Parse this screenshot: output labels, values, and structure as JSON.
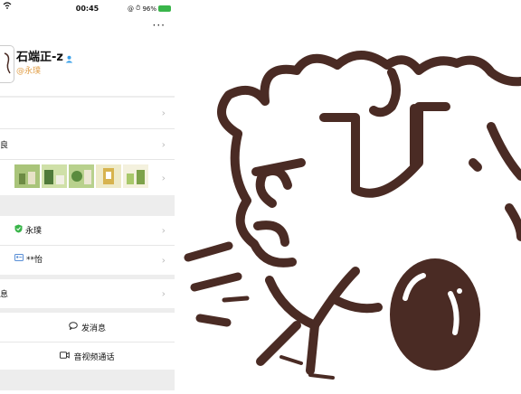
{
  "status": {
    "time": "00:45",
    "battery": "96%",
    "extra": "@"
  },
  "profile": {
    "more": "···",
    "name": "石端正-z",
    "username": "@永璞"
  },
  "rows": {
    "r2": "良",
    "r5": "息"
  },
  "verified": {
    "name": "永璞"
  },
  "id": {
    "name": "**怡"
  },
  "actions": {
    "send": "发消息",
    "video": "音视频通话"
  },
  "colors": {
    "accent": "#e2a04a",
    "green": "#39b54a",
    "artStroke": "#4a2b24"
  }
}
